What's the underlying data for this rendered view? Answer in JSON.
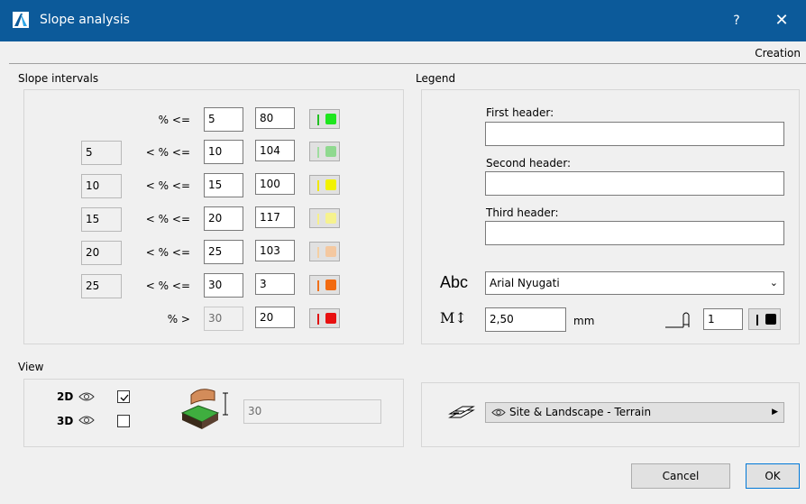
{
  "window": {
    "title": "Slope analysis",
    "help": "?",
    "close": "✕",
    "creation": "Creation"
  },
  "slope": {
    "label": "Slope intervals",
    "rows": [
      {
        "low": "",
        "op": "% <=",
        "high": "5",
        "pen": "80",
        "bar": "#21c021",
        "sq": "#1ee61e"
      },
      {
        "low": "5",
        "op": "< % <=",
        "high": "10",
        "pen": "104",
        "bar": "#9fdd9f",
        "sq": "#8fd98f"
      },
      {
        "low": "10",
        "op": "< % <=",
        "high": "15",
        "pen": "100",
        "bar": "#f0e800",
        "sq": "#f2f200"
      },
      {
        "low": "15",
        "op": "< % <=",
        "high": "20",
        "pen": "117",
        "bar": "#f6f08a",
        "sq": "#f6f28e"
      },
      {
        "low": "20",
        "op": "< % <=",
        "high": "25",
        "pen": "103",
        "bar": "#f4cfa3",
        "sq": "#f4c8a0"
      },
      {
        "low": "25",
        "op": "< % <=",
        "high": "30",
        "pen": "3",
        "bar": "#f07018",
        "sq": "#f26a10"
      },
      {
        "low": "",
        "op": "% >",
        "high": "30",
        "pen": "20",
        "bar": "#e01010",
        "sq": "#e81010"
      }
    ]
  },
  "legend": {
    "label": "Legend",
    "first_header": "First header:",
    "second_header": "Second header:",
    "third_header": "Third header:",
    "font_icon": "Abc",
    "font": "Arial Nyugati",
    "size_icon": "M↕",
    "size": "2,50",
    "unit": "mm",
    "pen": "1"
  },
  "view": {
    "label": "View",
    "two_d": "2D",
    "three_d": "3D",
    "two_d_checked": true,
    "three_d_checked": false,
    "elevation": "30"
  },
  "layer": {
    "name": "Site & Landscape - Terrain"
  },
  "buttons": {
    "cancel": "Cancel",
    "ok": "OK"
  }
}
